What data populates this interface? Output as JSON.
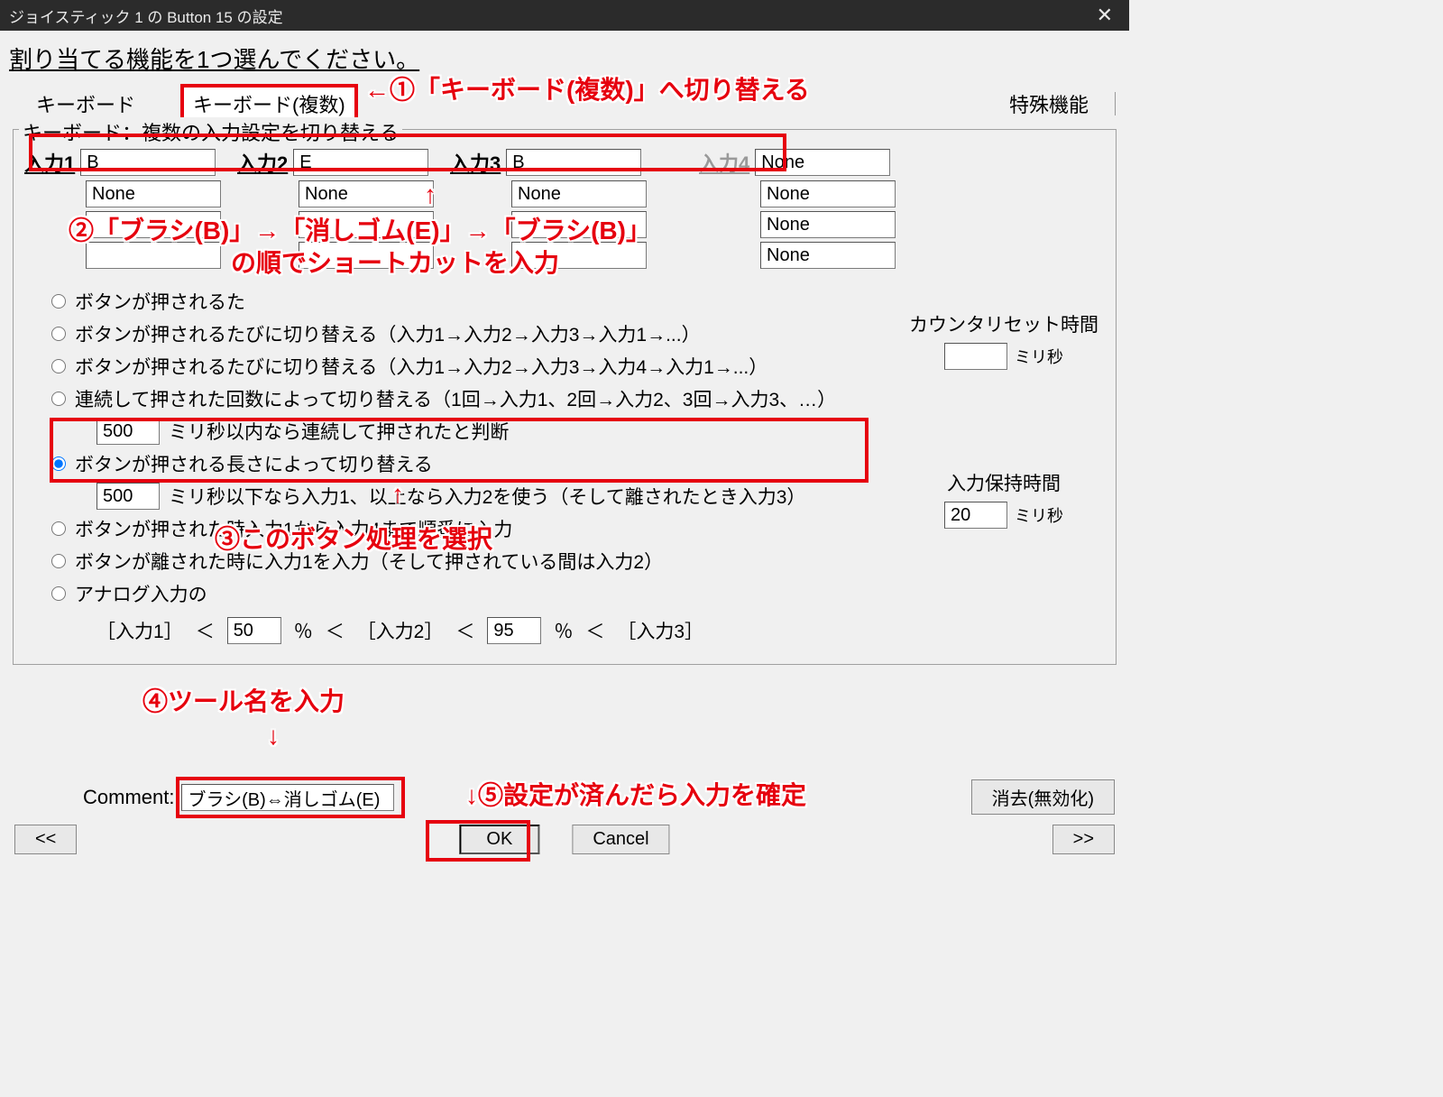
{
  "title": "ジョイスティック 1 の Button 15 の設定",
  "prompt": "割り当てる機能を1つ選んでください。",
  "tabs": {
    "keyboard": "キーボード",
    "keyboard_multi": "キーボード(複数)",
    "special": "特殊機能"
  },
  "group_title": "キーボード：複数の入力設定を切り替える",
  "input1": {
    "label": "入力1",
    "v1": "B",
    "v2": "None",
    "v3": "",
    "v4": ""
  },
  "input2": {
    "label": "入力2",
    "v1": "E",
    "v2": "None",
    "v3": "",
    "v4": ""
  },
  "input3": {
    "label": "入力3",
    "v1": "B",
    "v2": "None",
    "v3": "",
    "v4": ""
  },
  "input4": {
    "label": "入力4",
    "v1": "None",
    "v2": "None",
    "v3": "None",
    "v4": "None"
  },
  "options": [
    "ボタンが押されるた",
    "ボタンが押されるたびに切り替える（入力1→入力2→入力3→入力1→...）",
    "ボタンが押されるたびに切り替える（入力1→入力2→入力3→入力4→入力1→...）",
    "連続して押された回数によって切り替える（1回→入力1、2回→入力2、3回→入力3、…）"
  ],
  "opt_continuous_ms": "500",
  "opt_continuous_tail": "ミリ秒以内なら連続して押されたと判断",
  "opt_length": "ボタンが押される長さによって切り替える",
  "opt_length_ms": "500",
  "opt_length_tail": "ミリ秒以下なら入力1、以上なら入力2を使う（そして離されたとき入力3）",
  "opt_seq": "ボタンが押された時入力1から入力4まで順番に入力",
  "opt_release": "ボタンが離された時に入力1を入力（そして押されている間は入力2）",
  "opt_analog": "アナログ入力の",
  "analog": {
    "p1": "50",
    "p2": "95",
    "l1": "［入力1］",
    "l2": "［入力2］",
    "l3": "［入力3］",
    "lt": "＜",
    "pct": "％"
  },
  "counter_reset_label": "カウンタリセット時間",
  "counter_reset_unit": "ミリ秒",
  "counter_reset_val": "",
  "hold_label": "入力保持時間",
  "hold_unit": "ミリ秒",
  "hold_val": "20",
  "comment_label": "Comment:",
  "comment_val": "ブラシ(B)⇔消しゴム(E)",
  "clear_btn": "消去(無効化)",
  "ok": "OK",
  "cancel": "Cancel",
  "nav_prev": "<<",
  "nav_next": ">>",
  "annotations": {
    "a1": "←①「キーボード(複数)」へ切り替える",
    "a2a": "②「ブラシ(B)」→「消しゴム(E)」→「ブラシ(B)」",
    "a2b": "の順でショートカットを入力",
    "a3": "③このボタン処理を選択",
    "a4": "④ツール名を入力",
    "a4arrow": "↓",
    "a5": "↓⑤設定が済んだら入力を確定",
    "up_arrow": "↑"
  }
}
